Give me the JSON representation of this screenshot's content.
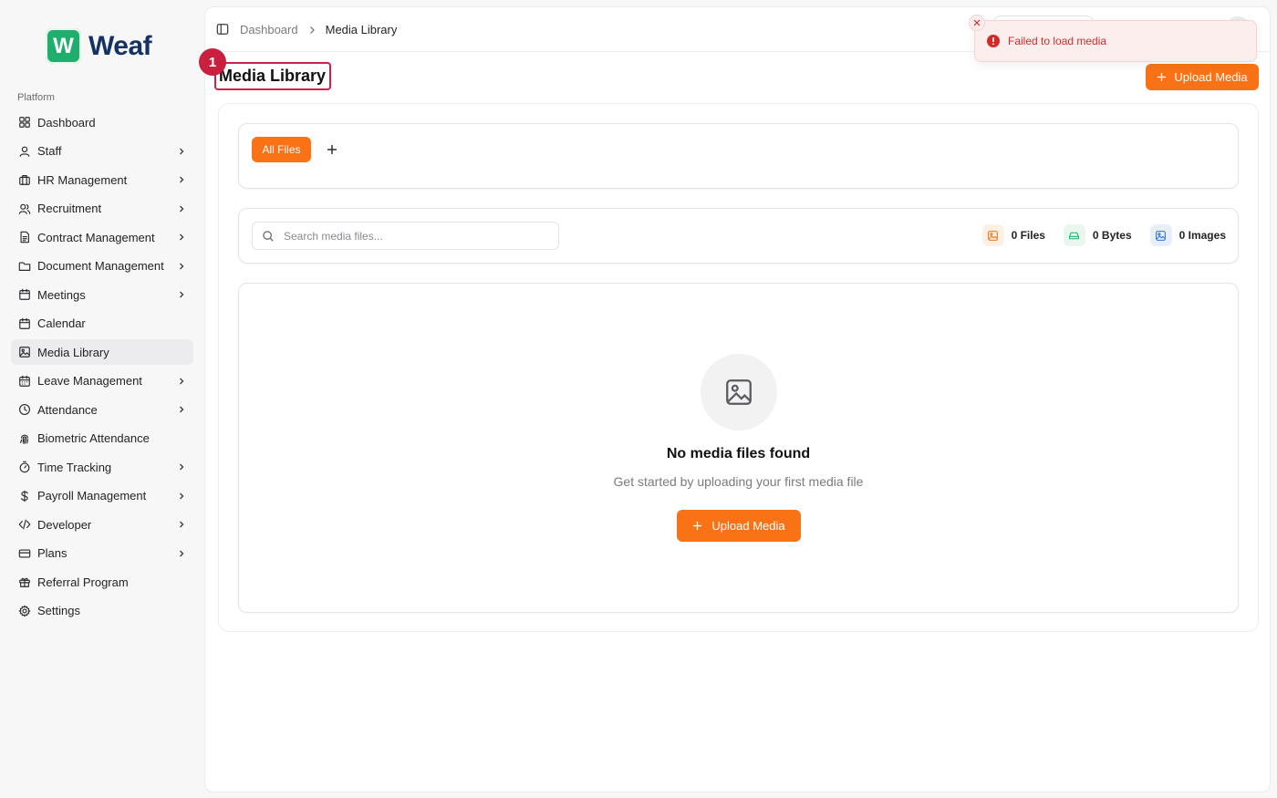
{
  "app": {
    "logo_letter": "W",
    "name": "Weaf",
    "brand_color": "#1fae6b",
    "accent_color": "#f97316"
  },
  "sidebar": {
    "section_label": "Platform",
    "items": [
      {
        "label": "Dashboard",
        "icon": "grid-icon",
        "has_chevron": false
      },
      {
        "label": "Staff",
        "icon": "user-icon",
        "has_chevron": true
      },
      {
        "label": "HR Management",
        "icon": "briefcase-icon",
        "has_chevron": true
      },
      {
        "label": "Recruitment",
        "icon": "users-icon",
        "has_chevron": true
      },
      {
        "label": "Contract Management",
        "icon": "file-text-icon",
        "has_chevron": true
      },
      {
        "label": "Document Management",
        "icon": "folder-icon",
        "has_chevron": true
      },
      {
        "label": "Meetings",
        "icon": "calendar-icon",
        "has_chevron": true
      },
      {
        "label": "Calendar",
        "icon": "calendar-icon",
        "has_chevron": false
      },
      {
        "label": "Media Library",
        "icon": "image-icon",
        "has_chevron": false,
        "active": true
      },
      {
        "label": "Leave Management",
        "icon": "calendar-days-icon",
        "has_chevron": true
      },
      {
        "label": "Attendance",
        "icon": "clock-icon",
        "has_chevron": true
      },
      {
        "label": "Biometric Attendance",
        "icon": "fingerprint-icon",
        "has_chevron": false
      },
      {
        "label": "Time Tracking",
        "icon": "timer-icon",
        "has_chevron": true
      },
      {
        "label": "Payroll Management",
        "icon": "dollar-icon",
        "has_chevron": true
      },
      {
        "label": "Developer",
        "icon": "code-icon",
        "has_chevron": true
      },
      {
        "label": "Plans",
        "icon": "credit-card-icon",
        "has_chevron": true
      },
      {
        "label": "Referral Program",
        "icon": "gift-icon",
        "has_chevron": false
      },
      {
        "label": "Settings",
        "icon": "gear-icon",
        "has_chevron": false
      }
    ]
  },
  "breadcrumb": {
    "parent": "Dashboard",
    "current": "Media Library"
  },
  "page": {
    "title": "Media Library",
    "marker": "1",
    "upload_label": "Upload Media"
  },
  "tabs": {
    "all_files": "All Files"
  },
  "search": {
    "placeholder": "Search media files..."
  },
  "stats": {
    "files": "0 Files",
    "bytes": "0 Bytes",
    "images": "0 Images"
  },
  "empty_state": {
    "title": "No media files found",
    "subtitle": "Get started by uploading your first media file",
    "upload_label": "Upload Media"
  },
  "toast": {
    "message": "Failed to load media",
    "status_color": "#d42a2a"
  }
}
